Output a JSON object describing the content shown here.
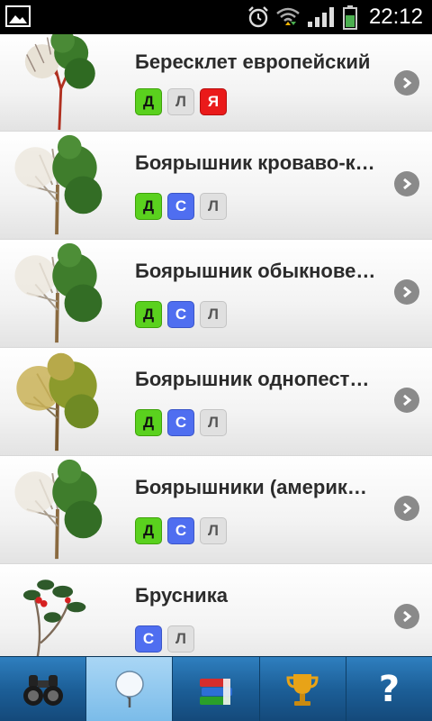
{
  "status_bar": {
    "time": "22:12",
    "icons": [
      "gallery-icon",
      "alarm-icon",
      "wifi-icon",
      "signal-icon",
      "battery-icon"
    ]
  },
  "plants": [
    {
      "name": "Бересклет европейский",
      "badges": [
        {
          "letter": "Д",
          "kind": "d"
        },
        {
          "letter": "Л",
          "kind": "l"
        },
        {
          "letter": "Я",
          "kind": "ya"
        }
      ],
      "thumb": "tree-icon"
    },
    {
      "name": "Боярышник кроваво-красный",
      "badges": [
        {
          "letter": "Д",
          "kind": "d"
        },
        {
          "letter": "С",
          "kind": "s"
        },
        {
          "letter": "Л",
          "kind": "l"
        }
      ],
      "thumb": "tree-icon"
    },
    {
      "name": "Боярышник обыкновенный",
      "badges": [
        {
          "letter": "Д",
          "kind": "d"
        },
        {
          "letter": "С",
          "kind": "s"
        },
        {
          "letter": "Л",
          "kind": "l"
        }
      ],
      "thumb": "tree-icon"
    },
    {
      "name": "Боярышник однопестичный",
      "badges": [
        {
          "letter": "Д",
          "kind": "d"
        },
        {
          "letter": "С",
          "kind": "s"
        },
        {
          "letter": "Л",
          "kind": "l"
        }
      ],
      "thumb": "tree-yellow-icon"
    },
    {
      "name": "Боярышники (американские)",
      "badges": [
        {
          "letter": "Д",
          "kind": "d"
        },
        {
          "letter": "С",
          "kind": "s"
        },
        {
          "letter": "Л",
          "kind": "l"
        }
      ],
      "thumb": "tree-icon"
    },
    {
      "name": "Брусника",
      "badges": [
        {
          "letter": "С",
          "kind": "s"
        },
        {
          "letter": "Л",
          "kind": "l"
        }
      ],
      "thumb": "shrub-berry-icon"
    }
  ],
  "colors": {
    "badge_d": "#5ad11e",
    "badge_s": "#4f6ef0",
    "badge_l": "#e0e0e0",
    "badge_ya": "#ea1a1a",
    "toolbar": "#1c5f98",
    "toolbar_active": "#7bbce9"
  },
  "toolbar": [
    {
      "name": "binoculars",
      "icon": "binoculars-icon",
      "active": false
    },
    {
      "name": "trees",
      "icon": "tree-icon",
      "active": true
    },
    {
      "name": "books",
      "icon": "books-icon",
      "active": false
    },
    {
      "name": "trophy",
      "icon": "trophy-icon",
      "active": false
    },
    {
      "name": "help",
      "icon": "question-icon",
      "label": "?",
      "active": false
    }
  ]
}
